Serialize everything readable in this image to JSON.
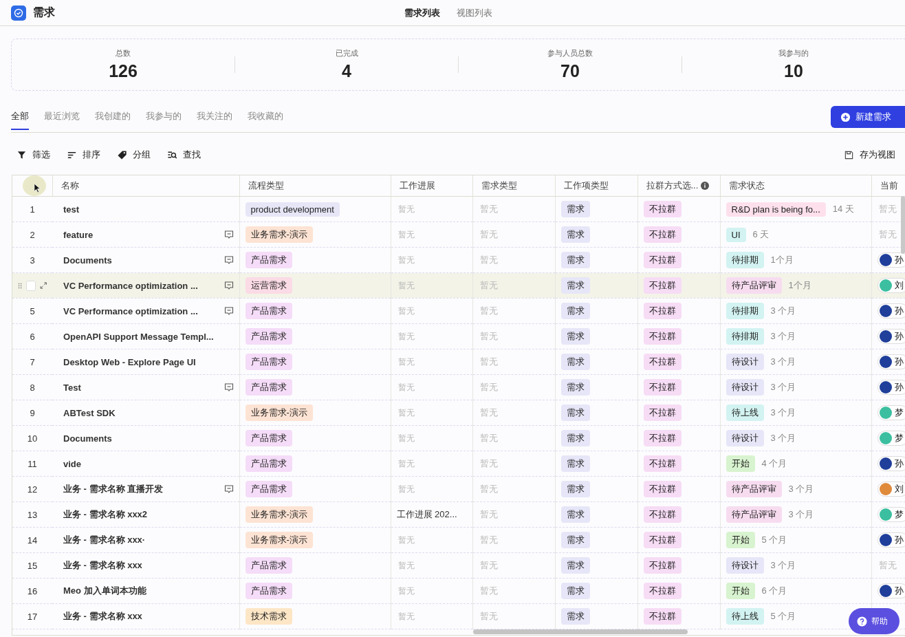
{
  "app": {
    "title": "需求"
  },
  "nav_tabs": [
    {
      "label": "需求列表",
      "selected": true
    },
    {
      "label": "视图列表",
      "selected": false
    }
  ],
  "stats": [
    {
      "label": "总数",
      "value": "126"
    },
    {
      "label": "已完成",
      "value": "4"
    },
    {
      "label": "参与人员总数",
      "value": "70"
    },
    {
      "label": "我参与的",
      "value": "10"
    }
  ],
  "filter_tabs": [
    {
      "label": "全部",
      "selected": true
    },
    {
      "label": "最近浏览",
      "selected": false
    },
    {
      "label": "我创建的",
      "selected": false
    },
    {
      "label": "我参与的",
      "selected": false
    },
    {
      "label": "我关注的",
      "selected": false
    },
    {
      "label": "我收藏的",
      "selected": false
    }
  ],
  "new_button": "新建需求",
  "toolbar": [
    {
      "kind": "filter",
      "label": "筛选"
    },
    {
      "kind": "sort",
      "label": "排序"
    },
    {
      "kind": "group",
      "label": "分组"
    },
    {
      "kind": "find",
      "label": "查找"
    }
  ],
  "save_view": "存为视图",
  "table": {
    "columns": [
      "名称",
      "流程类型",
      "工作进展",
      "需求类型",
      "工作项类型",
      "拉群方式选...",
      "需求状态",
      "当前"
    ],
    "rows": [
      {
        "number": "1",
        "hovered": false,
        "name": "test",
        "comment": false,
        "flow": {
          "text": "product development",
          "color": "#e6e6f7"
        },
        "progress": "暂无",
        "demand_type": "暂无",
        "item_type": "需求",
        "group": "不拉群",
        "status": {
          "text": "R&D plan is being fo...",
          "color": "#fde0ec"
        },
        "age": "14 天",
        "owner": {
          "empty": "暂无"
        }
      },
      {
        "number": "2",
        "hovered": false,
        "name": "feature",
        "comment": true,
        "flow": {
          "text": "业务需求-演示",
          "color": "#fde3d3"
        },
        "progress": "暂无",
        "demand_type": "暂无",
        "item_type": "需求",
        "group": "不拉群",
        "status": {
          "text": "UI",
          "color": "#d2f3f1"
        },
        "age": "6 天",
        "owner": {
          "empty": "暂无"
        }
      },
      {
        "number": "3",
        "hovered": false,
        "name": "Documents",
        "comment": true,
        "flow": {
          "text": "产品需求",
          "color": "#f5dcf8"
        },
        "progress": "暂无",
        "demand_type": "暂无",
        "item_type": "需求",
        "group": "不拉群",
        "status": {
          "text": "待排期",
          "color": "#d2f3f1"
        },
        "age": "1个月",
        "owner": {
          "name": "孙",
          "color": "#1f3f9a"
        }
      },
      {
        "hovered": true,
        "name": "VC Performance optimization ...",
        "comment": true,
        "flow": {
          "text": "运营需求",
          "color": "#fbdbe5"
        },
        "progress": "暂无",
        "demand_type": "暂无",
        "item_type": "需求",
        "group": "不拉群",
        "status": {
          "text": "待产品评审",
          "color": "#f7dcf0"
        },
        "age": "1个月",
        "owner": {
          "name": "刘",
          "color": "#3cbfa0"
        }
      },
      {
        "number": "5",
        "hovered": false,
        "name": "VC Performance optimization ...",
        "comment": true,
        "flow": {
          "text": "产品需求",
          "color": "#f5dcf8"
        },
        "progress": "暂无",
        "demand_type": "暂无",
        "item_type": "需求",
        "group": "不拉群",
        "status": {
          "text": "待排期",
          "color": "#d2f3f1"
        },
        "age": "3 个月",
        "owner": {
          "name": "孙",
          "color": "#1f3f9a"
        }
      },
      {
        "number": "6",
        "hovered": false,
        "name": "OpenAPI Support Message Templ...",
        "comment": false,
        "flow": {
          "text": "产品需求",
          "color": "#f5dcf8"
        },
        "progress": "暂无",
        "demand_type": "暂无",
        "item_type": "需求",
        "group": "不拉群",
        "status": {
          "text": "待排期",
          "color": "#d2f3f1"
        },
        "age": "3 个月",
        "owner": {
          "name": "孙",
          "color": "#1f3f9a"
        }
      },
      {
        "number": "7",
        "hovered": false,
        "name": "Desktop Web - Explore Page UI",
        "comment": false,
        "flow": {
          "text": "产品需求",
          "color": "#f5dcf8"
        },
        "progress": "暂无",
        "demand_type": "暂无",
        "item_type": "需求",
        "group": "不拉群",
        "status": {
          "text": "待设计",
          "color": "#e6e6f8"
        },
        "age": "3 个月",
        "owner": {
          "name": "孙",
          "color": "#1f3f9a"
        }
      },
      {
        "number": "8",
        "hovered": false,
        "name": "Test",
        "comment": true,
        "flow": {
          "text": "产品需求",
          "color": "#f5dcf8"
        },
        "progress": "暂无",
        "demand_type": "暂无",
        "item_type": "需求",
        "group": "不拉群",
        "status": {
          "text": "待设计",
          "color": "#e6e6f8"
        },
        "age": "3 个月",
        "owner": {
          "name": "孙",
          "color": "#1f3f9a"
        }
      },
      {
        "number": "9",
        "hovered": false,
        "name": "ABTest SDK",
        "comment": false,
        "flow": {
          "text": "业务需求-演示",
          "color": "#fde3d3"
        },
        "progress": "暂无",
        "demand_type": "暂无",
        "item_type": "需求",
        "group": "不拉群",
        "status": {
          "text": "待上线",
          "color": "#d2f3f1"
        },
        "age": "3 个月",
        "owner": {
          "name": "梦",
          "color": "#3cbfa0"
        }
      },
      {
        "number": "10",
        "hovered": false,
        "name": "Documents",
        "comment": false,
        "flow": {
          "text": "产品需求",
          "color": "#f5dcf8"
        },
        "progress": "暂无",
        "demand_type": "暂无",
        "item_type": "需求",
        "group": "不拉群",
        "status": {
          "text": "待设计",
          "color": "#e6e6f8"
        },
        "age": "3 个月",
        "owner": {
          "name": "梦",
          "color": "#3cbfa0"
        }
      },
      {
        "number": "11",
        "hovered": false,
        "name": "vide",
        "comment": false,
        "flow": {
          "text": "产品需求",
          "color": "#f5dcf8"
        },
        "progress": "暂无",
        "demand_type": "暂无",
        "item_type": "需求",
        "group": "不拉群",
        "status": {
          "text": "开始",
          "color": "#d8f3cf"
        },
        "age": "4 个月",
        "owner": {
          "name": "孙",
          "color": "#1f3f9a"
        }
      },
      {
        "number": "12",
        "hovered": false,
        "name": "业务 - 需求名称 直播开发",
        "comment": true,
        "flow": {
          "text": "产品需求",
          "color": "#f5dcf8"
        },
        "progress": "暂无",
        "demand_type": "暂无",
        "item_type": "需求",
        "group": "不拉群",
        "status": {
          "text": "待产品评审",
          "color": "#f7dcf0"
        },
        "age": "3 个月",
        "owner": {
          "name": "刘",
          "color": "#e08a3c"
        }
      },
      {
        "number": "13",
        "hovered": false,
        "name": "业务 - 需求名称 xxx2",
        "comment": false,
        "flow": {
          "text": "业务需求-演示",
          "color": "#fde3d3"
        },
        "progress": "工作进展 202...",
        "demand_type": "暂无",
        "item_type": "需求",
        "group": "不拉群",
        "status": {
          "text": "待产品评审",
          "color": "#f7dcf0"
        },
        "age": "3 个月",
        "owner": {
          "name": "梦",
          "color": "#3cbfa0"
        }
      },
      {
        "number": "14",
        "hovered": false,
        "name": "业务 - 需求名称 xxx·",
        "comment": false,
        "flow": {
          "text": "业务需求-演示",
          "color": "#fde3d3"
        },
        "progress": "暂无",
        "demand_type": "暂无",
        "item_type": "需求",
        "group": "不拉群",
        "status": {
          "text": "开始",
          "color": "#d8f3cf"
        },
        "age": "5 个月",
        "owner": {
          "name": "孙",
          "color": "#1f3f9a"
        }
      },
      {
        "number": "15",
        "hovered": false,
        "name": "业务 - 需求名称 xxx",
        "comment": false,
        "flow": {
          "text": "产品需求",
          "color": "#f5dcf8"
        },
        "progress": "暂无",
        "demand_type": "暂无",
        "item_type": "需求",
        "group": "不拉群",
        "status": {
          "text": "待设计",
          "color": "#e6e6f8"
        },
        "age": "3 个月",
        "owner": {
          "empty": "暂无"
        }
      },
      {
        "number": "16",
        "hovered": false,
        "name": "Meo 加入单词本功能",
        "comment": false,
        "flow": {
          "text": "产品需求",
          "color": "#f5dcf8"
        },
        "progress": "暂无",
        "demand_type": "暂无",
        "item_type": "需求",
        "group": "不拉群",
        "status": {
          "text": "开始",
          "color": "#d8f3cf"
        },
        "age": "6 个月",
        "owner": {
          "name": "孙",
          "color": "#1f3f9a"
        }
      },
      {
        "number": "17",
        "hovered": false,
        "name": "业务 - 需求名称 xxx",
        "comment": false,
        "flow": {
          "text": "技术需求",
          "color": "#fde6c6"
        },
        "progress": "暂无",
        "demand_type": "暂无",
        "item_type": "需求",
        "group": "不拉群",
        "status": {
          "text": "待上线",
          "color": "#d2f3f1"
        },
        "age": "5 个月"
      }
    ]
  },
  "help_button": "帮助"
}
